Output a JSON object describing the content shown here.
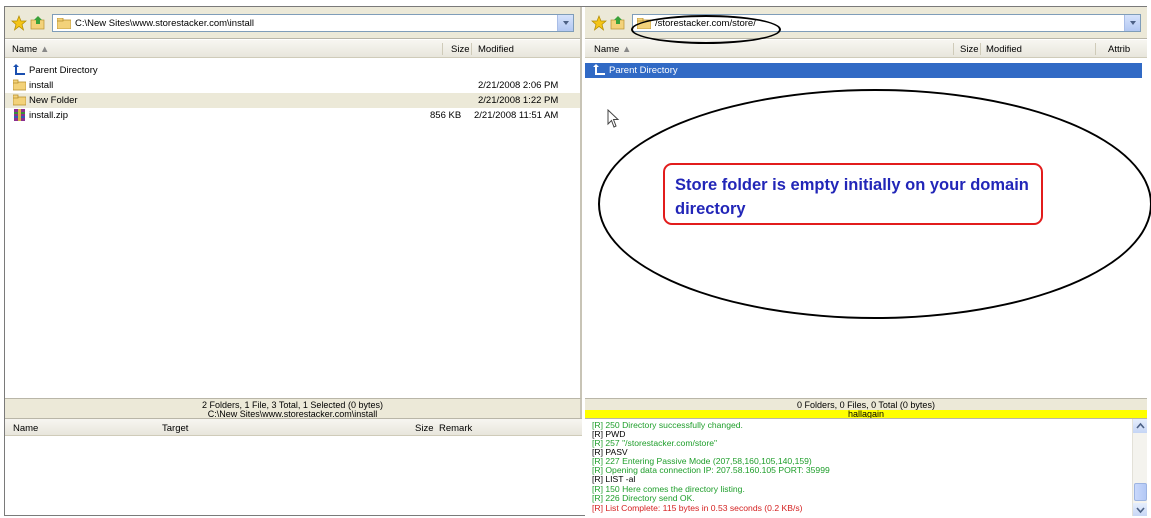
{
  "left_pane": {
    "path": "C:\\New Sites\\www.storestacker.com\\install",
    "columns": {
      "name": "Name",
      "size": "Size",
      "modified": "Modified"
    },
    "rows": [
      {
        "name": "Parent Directory",
        "size": "",
        "modified": "",
        "icon": "up-arrow-icon"
      },
      {
        "name": "install",
        "size": "",
        "modified": "2/21/2008 2:06 PM",
        "icon": "folder-icon"
      },
      {
        "name": "New Folder",
        "size": "",
        "modified": "2/21/2008 1:22 PM",
        "icon": "folder-icon"
      },
      {
        "name": "install.zip",
        "size": "856 KB",
        "modified": "2/21/2008 11:51 AM",
        "icon": "zip-archive-icon"
      }
    ],
    "status_line1": "2 Folders, 1 File, 3 Total, 1 Selected (0 bytes)",
    "status_line2": "C:\\New Sites\\www.storestacker.com\\install"
  },
  "right_pane": {
    "path": "/storestacker.com/store/",
    "columns": {
      "name": "Name",
      "size": "Size",
      "modified": "Modified",
      "attrib": "Attrib"
    },
    "rows": [
      {
        "name": "Parent Directory",
        "icon": "up-arrow-icon"
      }
    ],
    "status_line1": "0 Folders, 0 Files, 0 Total (0 bytes)",
    "status_line2": "hallagain"
  },
  "queue": {
    "columns": {
      "name": "Name",
      "target": "Target",
      "size": "Size",
      "remark": "Remark"
    }
  },
  "log": [
    {
      "text": "[R] 250 Directory successfully changed.",
      "color": "g"
    },
    {
      "text": "[R] PWD",
      "color": "k"
    },
    {
      "text": "[R] 257 \"/storestacker.com/store\"",
      "color": "g"
    },
    {
      "text": "[R] PASV",
      "color": "k"
    },
    {
      "text": "[R] 227 Entering Passive Mode (207,58,160,105,140,159)",
      "color": "g"
    },
    {
      "text": "[R] Opening data connection IP: 207.58.160.105 PORT: 35999",
      "color": "g"
    },
    {
      "text": "[R] LIST -al",
      "color": "k"
    },
    {
      "text": "[R] 150 Here comes the directory listing.",
      "color": "g"
    },
    {
      "text": "[R] 226 Directory send OK.",
      "color": "g"
    },
    {
      "text": "[R] List Complete: 115 bytes in 0.53 seconds (0.2 KB/s)",
      "color": "r"
    }
  ],
  "annotation": {
    "callout_text": "Store folder is empty initially on your domain directory"
  },
  "colors": {
    "selection": "#316ac5",
    "status_highlight": "#ffff00",
    "callout_text": "#2226b8",
    "callout_border": "#e21c1c",
    "log_ok": "#1e9e2a",
    "log_complete": "#d42020"
  }
}
